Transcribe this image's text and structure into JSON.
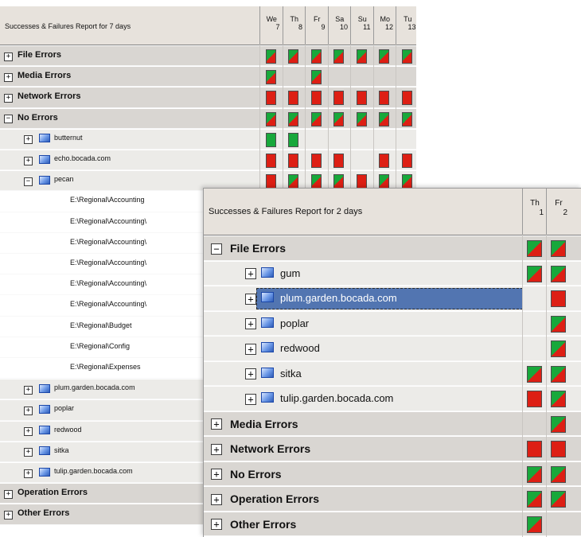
{
  "panel1": {
    "title": "Successes & Failures Report for 7 days",
    "days": [
      {
        "name": "We",
        "num": "7"
      },
      {
        "name": "Th",
        "num": "8"
      },
      {
        "name": "Fr",
        "num": "9"
      },
      {
        "name": "Sa",
        "num": "10"
      },
      {
        "name": "Su",
        "num": "11"
      },
      {
        "name": "Mo",
        "num": "12"
      },
      {
        "name": "Tu",
        "num": "13"
      }
    ],
    "rows": [
      {
        "label": "File Errors",
        "type": "top",
        "expanded": false,
        "cells": [
          "mix",
          "mix",
          "mix",
          "mix",
          "mix",
          "mix",
          "mix"
        ]
      },
      {
        "label": "Media Errors",
        "type": "top",
        "expanded": false,
        "cells": [
          "mix",
          "",
          "mix",
          "",
          "",
          "",
          ""
        ]
      },
      {
        "label": "Network Errors",
        "type": "top",
        "expanded": false,
        "cells": [
          "red",
          "red",
          "red",
          "red",
          "red",
          "red",
          "red"
        ]
      },
      {
        "label": "No Errors",
        "type": "top",
        "expanded": true,
        "cells": [
          "mix",
          "mix",
          "mix",
          "mix",
          "mix",
          "mix",
          "mix"
        ]
      },
      {
        "label": "butternut",
        "type": "server",
        "expanded": false,
        "cells": [
          "green",
          "green",
          "",
          "",
          "",
          "",
          ""
        ]
      },
      {
        "label": "echo.bocada.com",
        "type": "server",
        "expanded": false,
        "cells": [
          "red",
          "red",
          "red",
          "red",
          "",
          "red",
          "red"
        ]
      },
      {
        "label": "pecan",
        "type": "server",
        "expanded": true,
        "cells": [
          "red",
          "mix",
          "mix",
          "mix",
          "red",
          "mix",
          "mix"
        ]
      },
      {
        "label": "E:\\Regional\\Accounting",
        "type": "path",
        "cells": []
      },
      {
        "label": "E:\\Regional\\Accounting\\",
        "type": "path",
        "cells": []
      },
      {
        "label": "E:\\Regional\\Accounting\\",
        "type": "path",
        "cells": []
      },
      {
        "label": "E:\\Regional\\Accounting\\",
        "type": "path",
        "cells": []
      },
      {
        "label": "E:\\Regional\\Accounting\\",
        "type": "path",
        "cells": []
      },
      {
        "label": "E:\\Regional\\Accounting\\",
        "type": "path",
        "cells": []
      },
      {
        "label": "E:\\Regional\\Budget",
        "type": "path",
        "cells": []
      },
      {
        "label": "E:\\Regional\\Config",
        "type": "path",
        "cells": []
      },
      {
        "label": "E:\\Regional\\Expenses",
        "type": "path",
        "cells": []
      },
      {
        "label": "plum.garden.bocada.com",
        "type": "server",
        "expanded": false,
        "cells": []
      },
      {
        "label": "poplar",
        "type": "server",
        "expanded": false,
        "cells": []
      },
      {
        "label": "redwood",
        "type": "server",
        "expanded": false,
        "cells": []
      },
      {
        "label": "sitka",
        "type": "server",
        "expanded": false,
        "cells": []
      },
      {
        "label": "tulip.garden.bocada.com",
        "type": "server",
        "expanded": false,
        "cells": []
      },
      {
        "label": "Operation Errors",
        "type": "top",
        "expanded": false,
        "cells": []
      },
      {
        "label": "Other Errors",
        "type": "top",
        "expanded": false,
        "cells": []
      }
    ]
  },
  "panel2": {
    "title": "Successes & Failures Report for 2 days",
    "days": [
      {
        "name": "Th",
        "num": "1"
      },
      {
        "name": "Fr",
        "num": "2"
      }
    ],
    "rows": [
      {
        "label": "File Errors",
        "type": "top",
        "expanded": true,
        "cells": [
          "mix",
          "mix"
        ]
      },
      {
        "label": "gum",
        "type": "server",
        "expanded": false,
        "cells": [
          "mix",
          "mix"
        ]
      },
      {
        "label": "plum.garden.bocada.com",
        "type": "server",
        "expanded": false,
        "selected": true,
        "cells": [
          "",
          "red"
        ]
      },
      {
        "label": "poplar",
        "type": "server",
        "expanded": false,
        "cells": [
          "",
          "mix"
        ]
      },
      {
        "label": "redwood",
        "type": "server",
        "expanded": false,
        "cells": [
          "",
          "mix"
        ]
      },
      {
        "label": "sitka",
        "type": "server",
        "expanded": false,
        "cells": [
          "mix",
          "mix"
        ]
      },
      {
        "label": "tulip.garden.bocada.com",
        "type": "server",
        "expanded": false,
        "cells": [
          "red",
          "mix"
        ]
      },
      {
        "label": "Media Errors",
        "type": "top",
        "expanded": false,
        "cells": [
          "",
          "mix"
        ]
      },
      {
        "label": "Network Errors",
        "type": "top",
        "expanded": false,
        "cells": [
          "red",
          "red"
        ]
      },
      {
        "label": "No Errors",
        "type": "top",
        "expanded": false,
        "cells": [
          "mix",
          "mix"
        ]
      },
      {
        "label": "Operation Errors",
        "type": "top",
        "expanded": false,
        "cells": [
          "mix",
          "mix"
        ]
      },
      {
        "label": "Other Errors",
        "type": "top",
        "expanded": false,
        "cells": [
          "mix",
          ""
        ]
      }
    ]
  },
  "status_colors": {
    "success": "#18a83b",
    "failure": "#dd1f14"
  },
  "icons": {
    "expand": "plus-box-icon",
    "collapse": "minus-box-icon",
    "server": "server-icon"
  }
}
